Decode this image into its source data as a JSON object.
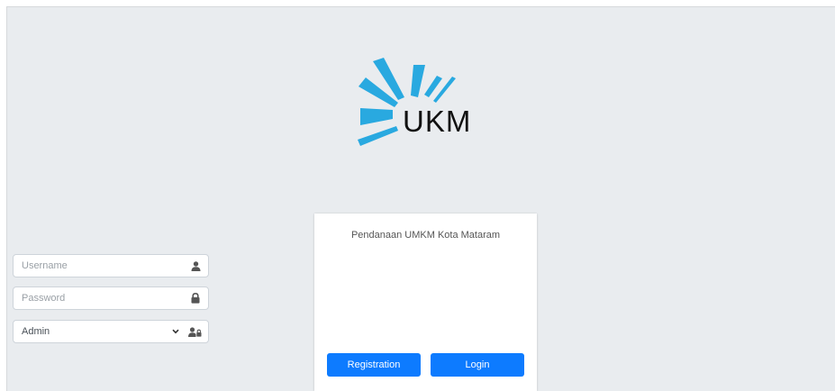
{
  "logo": {
    "text": "UKM",
    "color": "#29a9e0"
  },
  "card": {
    "title": "Pendanaan UMKM Kota Mataram"
  },
  "form": {
    "username": {
      "placeholder": "Username",
      "value": "",
      "icon": "user-icon"
    },
    "password": {
      "placeholder": "Password",
      "value": "",
      "icon": "lock-icon"
    },
    "role": {
      "selected": "Admin",
      "icon": "user-lock-icon"
    }
  },
  "buttons": {
    "registration": "Registration",
    "login": "Login",
    "color": "#0d7bff"
  }
}
